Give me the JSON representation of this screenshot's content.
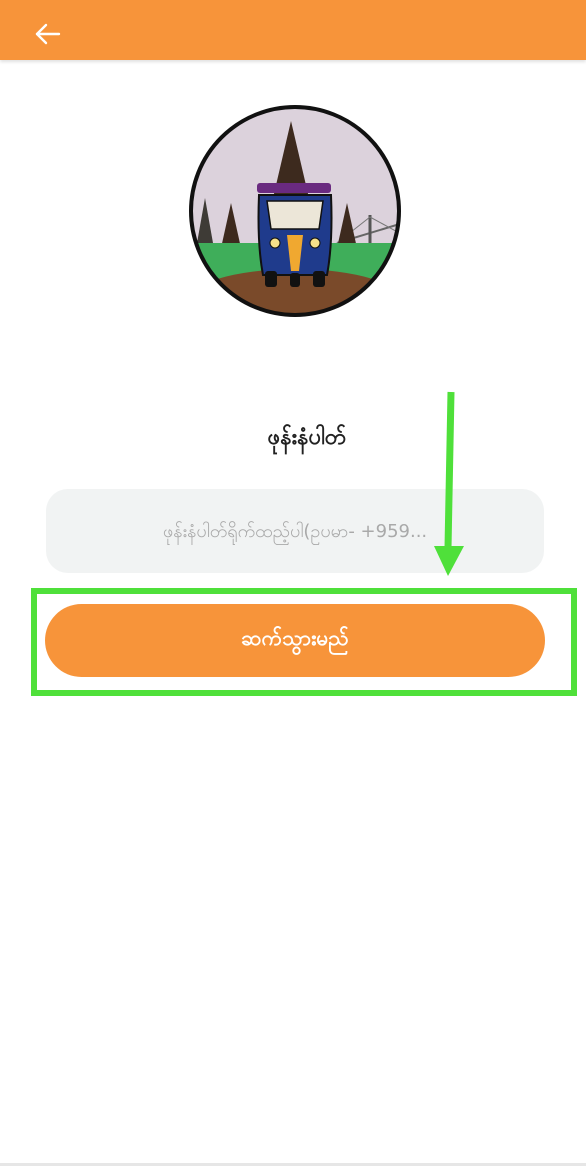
{
  "app_bar": {
    "color": "#f7943a",
    "back_icon": "arrow-left-icon"
  },
  "logo": {
    "icon": "tuk-tuk-temple-logo"
  },
  "form": {
    "label": "ဖုန်းနံပါတ်",
    "phone_placeholder": "ဖုန်းနံပါတ်ရိုက်ထည့်ပါ(ဥပမာ- +959...",
    "phone_value": "",
    "continue_label": "ဆက်သွားမည်"
  },
  "annotation": {
    "highlight_color": "#4fe03a",
    "arrow_icon": "arrow-down-icon"
  }
}
